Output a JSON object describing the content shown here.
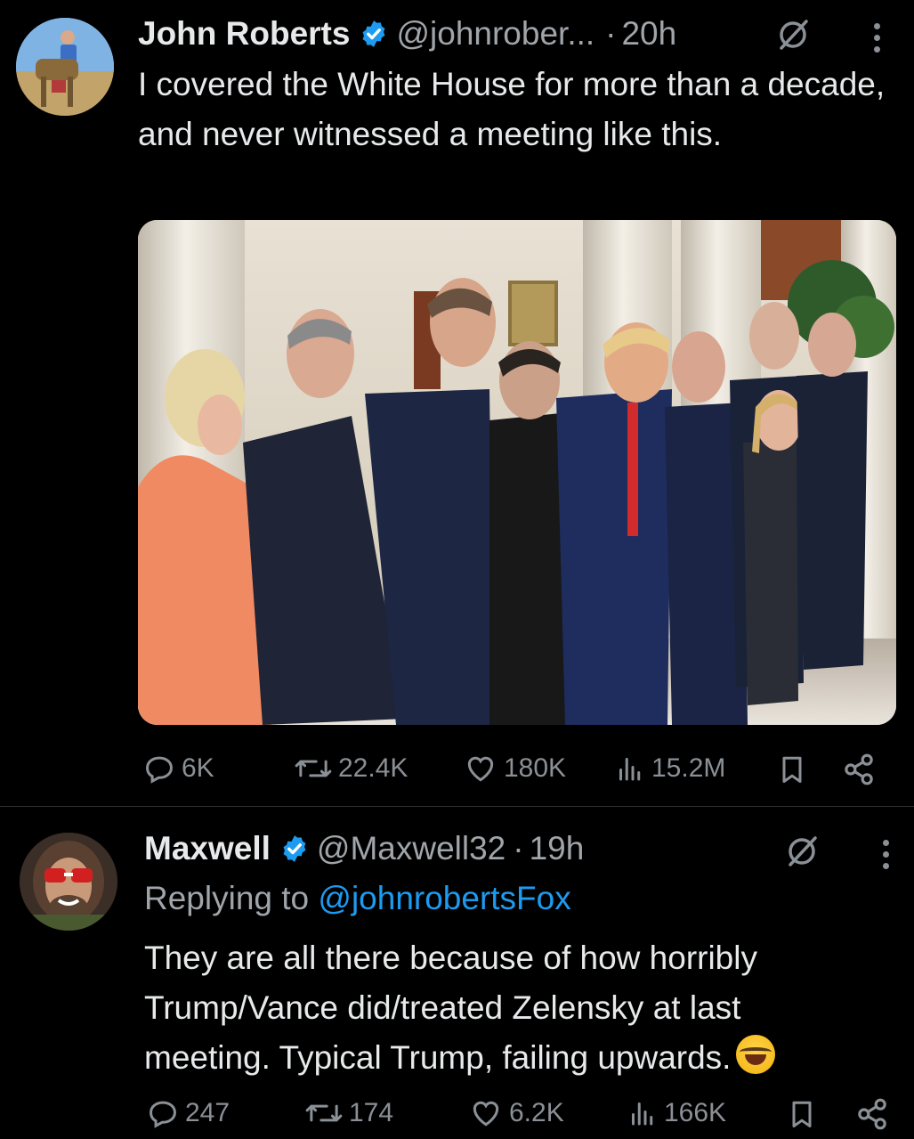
{
  "tweets": [
    {
      "author": "John Roberts",
      "handle": "@johnrober...",
      "separator": "·",
      "time": "20h",
      "text": "I covered the White House for more than a decade, and never witnessed a meeting like this.",
      "stats": {
        "replies": "6K",
        "reposts": "22.4K",
        "likes": "180K",
        "views": "15.2M"
      }
    },
    {
      "author": "Maxwell",
      "handle": "@Maxwell32",
      "separator": "·",
      "time": "19h",
      "reply_prefix": "Replying to",
      "reply_to": "@johnrobertsFox",
      "text": "They are all there because of how horribly Trump/Vance did/treated Zelensky at last meeting. Typical Trump, failing upwards.",
      "stats": {
        "replies": "247",
        "reposts": "174",
        "likes": "6.2K",
        "views": "166K"
      }
    }
  ],
  "colors": {
    "background": "#000000",
    "text": "#e7e9ea",
    "secondary": "#8b9096",
    "accent": "#1d9bf0"
  },
  "icons": [
    "verified-badge-icon",
    "grok-icon",
    "more-icon",
    "reply-icon",
    "repost-icon",
    "like-icon",
    "views-icon",
    "bookmark-icon",
    "share-icon"
  ]
}
